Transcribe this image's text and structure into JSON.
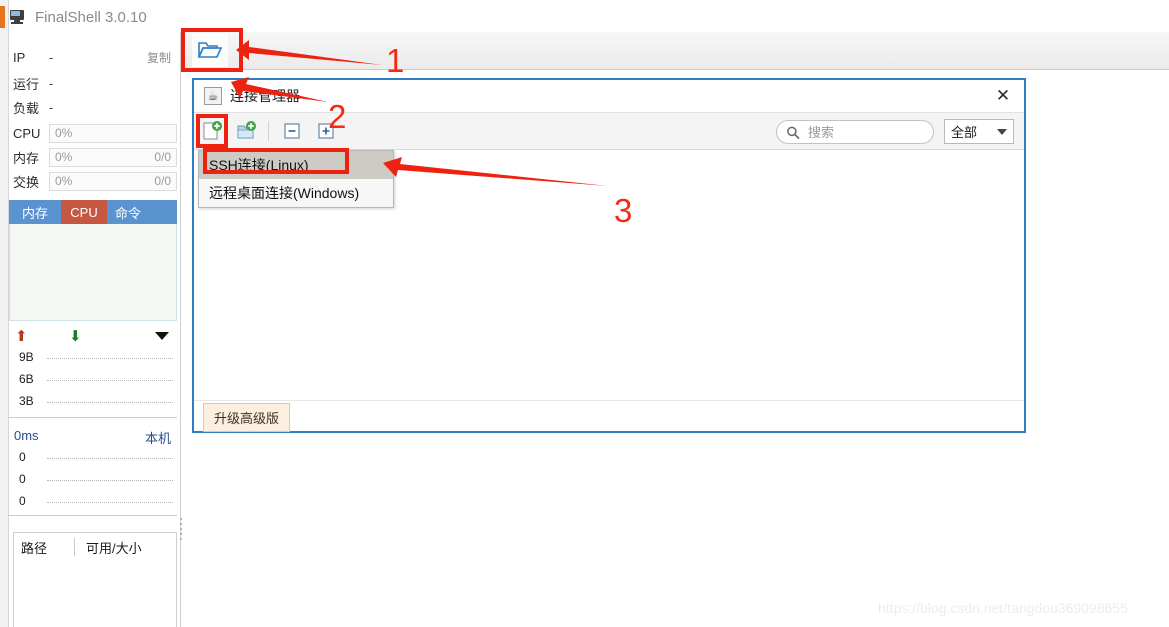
{
  "app": {
    "title": "FinalShell 3.0.10",
    "icon": "monitor-icon"
  },
  "toolbar": {
    "open_folder_icon": "folder-open-icon"
  },
  "info_panel": {
    "rows": [
      {
        "label": "IP",
        "value": "-",
        "action": "复制"
      },
      {
        "label": "运行",
        "value": "-"
      },
      {
        "label": "负载",
        "value": "-"
      }
    ],
    "metrics": [
      {
        "label": "CPU",
        "percent": "0%",
        "detail": ""
      },
      {
        "label": "内存",
        "percent": "0%",
        "detail": "0/0"
      },
      {
        "label": "交换",
        "percent": "0%",
        "detail": "0/0"
      }
    ],
    "tabs": [
      {
        "label": "内存",
        "active": false
      },
      {
        "label": "CPU",
        "active": true
      },
      {
        "label": "命令",
        "active": false
      }
    ],
    "network": {
      "up_icon": "arrow-up-icon",
      "down_icon": "arrow-down-icon",
      "menu_icon": "caret-down-icon",
      "axis_labels": [
        "9B",
        "6B",
        "3B"
      ]
    },
    "ping": {
      "latency": "0ms",
      "host": "本机",
      "axis_labels": [
        "0",
        "0",
        "0"
      ]
    },
    "disk": {
      "columns": [
        "路径",
        "可用/大小"
      ],
      "rows": []
    }
  },
  "dialog": {
    "icon": "java-icon",
    "title": "连接管理器",
    "close_icon": "close-icon",
    "toolbar_buttons": [
      {
        "name": "new-connection",
        "icon": "new-file-plus-icon"
      },
      {
        "name": "new-folder",
        "icon": "new-folder-plus-icon"
      },
      {
        "name": "collapse-all",
        "icon": "collapse-minus-icon"
      },
      {
        "name": "expand-all",
        "icon": "expand-plus-icon"
      }
    ],
    "search": {
      "placeholder": "搜索",
      "value": "",
      "icon": "search-icon"
    },
    "filter": {
      "selected": "全部",
      "icon": "chevron-down-icon"
    },
    "footer": {
      "upgrade_label": "升级高级版"
    },
    "context_menu": [
      {
        "label": "SSH连接(Linux)",
        "selected": true
      },
      {
        "label": "远程桌面连接(Windows)",
        "selected": false
      }
    ]
  },
  "annotations": {
    "numbers": [
      "1",
      "2",
      "3"
    ],
    "color": "#f42a12"
  },
  "watermark": "https://blog.csdn.net/tangdou369098655"
}
